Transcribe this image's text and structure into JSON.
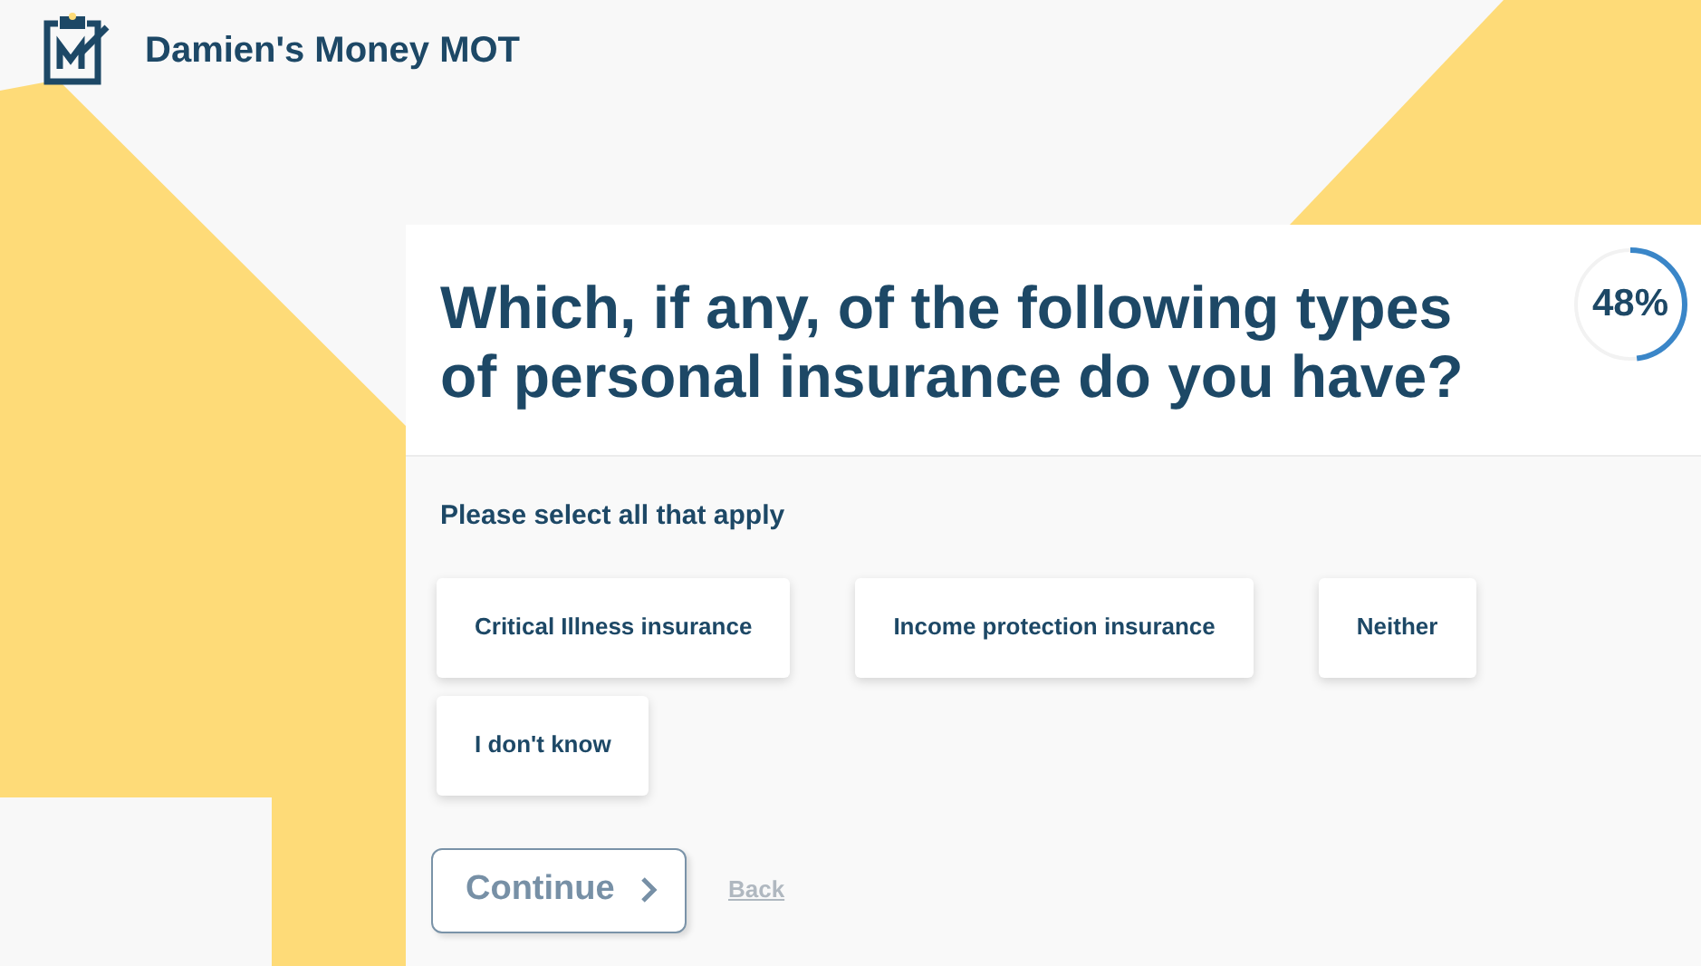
{
  "header": {
    "title": "Damien's Money MOT"
  },
  "question": {
    "title": "Which, if any, of the following types of personal insurance do you have?",
    "progress": {
      "reading": "48%",
      "level": 0.48
    }
  },
  "instruction": "Please select all that apply",
  "options": [
    {
      "label": "Critical Illness insurance",
      "selected": false
    },
    {
      "label": "Income protection insurance",
      "selected": false
    },
    {
      "label": "Neither",
      "selected": false
    },
    {
      "label": "I don't know",
      "selected": false
    }
  ],
  "continue_button": {
    "label": "Continue",
    "disabled": true
  },
  "back_link": "Back"
}
